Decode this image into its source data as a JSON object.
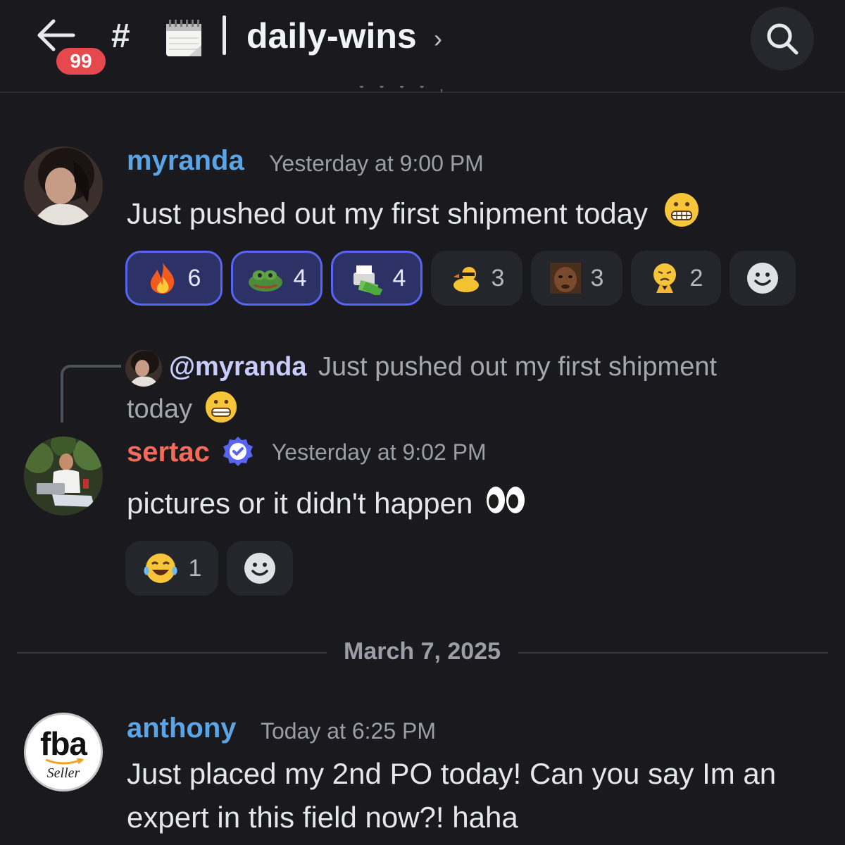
{
  "header": {
    "unread_count": "99",
    "hash": "#",
    "channel_name": "daily-wins",
    "chevron": "›",
    "partial_date": "• • • • ,"
  },
  "messages": [
    {
      "username": "myranda",
      "username_color": "#5ba4e6",
      "timestamp": "Yesterday at 9:00 PM",
      "text": "Just pushed out my first shipment today",
      "reactions": [
        {
          "emoji": "fire",
          "count": "6",
          "active": true
        },
        {
          "emoji": "pepe-frog",
          "count": "4",
          "active": true
        },
        {
          "emoji": "money-printer",
          "count": "4",
          "active": true
        },
        {
          "emoji": "duck",
          "count": "3",
          "active": false
        },
        {
          "emoji": "man-face",
          "count": "3",
          "active": false
        },
        {
          "emoji": "pleading-hands",
          "count": "2",
          "active": false
        }
      ]
    },
    {
      "reply_mention": "@myranda",
      "reply_text_line1": "Just pushed out my first shipment",
      "reply_text_line2": "today",
      "username": "sertac",
      "username_color": "#f26b5b",
      "timestamp": "Yesterday at 9:02 PM",
      "text": "pictures or it didn't happen",
      "reactions": [
        {
          "emoji": "tears-of-joy",
          "count": "1",
          "active": false
        }
      ]
    },
    {
      "username": "anthony",
      "username_color": "#5ba4e6",
      "timestamp": "Today at 6:25 PM",
      "text_line1": "Just placed my 2nd PO today!  Can you say Im an",
      "text_line2": "expert in this field now?! haha",
      "avatar_text1": "fba",
      "avatar_text2": "Seller"
    }
  ],
  "date_divider": "March 7, 2025"
}
